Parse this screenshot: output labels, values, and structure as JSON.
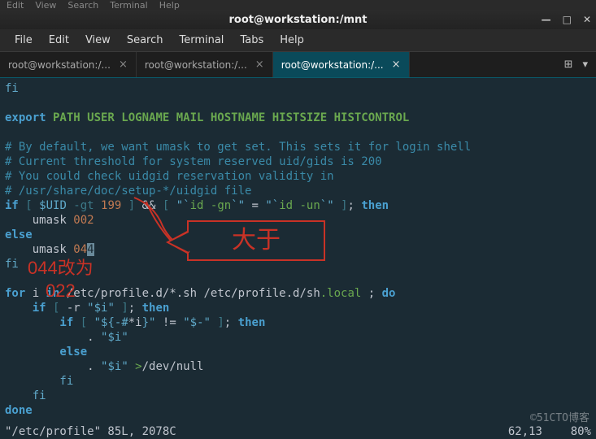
{
  "bg_menu": [
    "Edit",
    "View",
    "Search",
    "Terminal",
    "Help"
  ],
  "window": {
    "title": "root@workstation:/mnt",
    "min": "—",
    "max": "□",
    "close": "✕"
  },
  "menu": [
    "File",
    "Edit",
    "View",
    "Search",
    "Terminal",
    "Tabs",
    "Help"
  ],
  "tabs": [
    {
      "label": "root@workstation:/...",
      "active": false
    },
    {
      "label": "root@workstation:/...",
      "active": false
    },
    {
      "label": "root@workstation:/...",
      "active": true
    }
  ],
  "toolbar": {
    "new_tab_icon": "⊞",
    "menu_icon": "▾"
  },
  "code": {
    "l1": "fi",
    "l2a": "export",
    "l2b": " PATH USER LOGNAME MAIL HOSTNAME HISTSIZE HISTCONTROL",
    "l3": "# By default, we want umask to get set. This sets it for login shell",
    "l4": "# Current threshold for system reserved uid/gids is 200",
    "l5": "# You could check uidgid reservation validity in",
    "l6": "# /usr/share/doc/setup-*/uidgid file",
    "l7a": "if",
    "l7b": " [ ",
    "l7c": "$UID",
    "l7d": " -gt ",
    "l7e": "199",
    "l7f": " ]",
    "l7g": " && ",
    "l7h": "[ ",
    "l7i": "\"`",
    "l7j": "id -gn",
    "l7k": "`\" ",
    "l7l": "= ",
    "l7m": "\"`",
    "l7n": "id -un",
    "l7o": "`\"",
    "l7p": " ]",
    "l7q": "; ",
    "l7r": "then",
    "l8a": "    umask ",
    "l8b": "002",
    "l9": "else",
    "l10a": "    umask ",
    "l10b": "04",
    "l10c": "4",
    "l11": "fi",
    "l12a": "for",
    "l12b": " i ",
    "l12c": "in",
    "l12d": " /etc/profile.d/*.sh /etc/profile.d/sh",
    "l12e": ".local",
    "l12f": " ; ",
    "l12g": "do",
    "l13a": "    if",
    "l13b": " [ ",
    "l13c": "-r",
    "l13d": " \"",
    "l13e": "$i",
    "l13f": "\"",
    "l13g": " ]",
    "l13h": "; ",
    "l13i": "then",
    "l14a": "        if",
    "l14b": " [ ",
    "l14c": "\"",
    "l14d": "${-#",
    "l14e": "*i",
    "l14f": "}",
    "l14g": "\"",
    "l14h": " != ",
    "l14i": "\"",
    "l14j": "$-",
    "l14k": "\"",
    "l14l": " ]",
    "l14m": "; ",
    "l14n": "then",
    "l15a": "            . ",
    "l15b": "\"",
    "l15c": "$i",
    "l15d": "\"",
    "l16": "        else",
    "l17a": "            . ",
    "l17b": "\"",
    "l17c": "$i",
    "l17d": "\"",
    "l17e": " >",
    "l17f": "/dev/null",
    "l18": "        fi",
    "l19": "    fi",
    "l20": "done"
  },
  "status": {
    "left": "\"/etc/profile\" 85L, 2078C",
    "pos": "62,13",
    "pct": "80%"
  },
  "annot": {
    "box": "大于",
    "t1": "044改为",
    "t2": "022"
  },
  "watermark": "©51CTO博客"
}
